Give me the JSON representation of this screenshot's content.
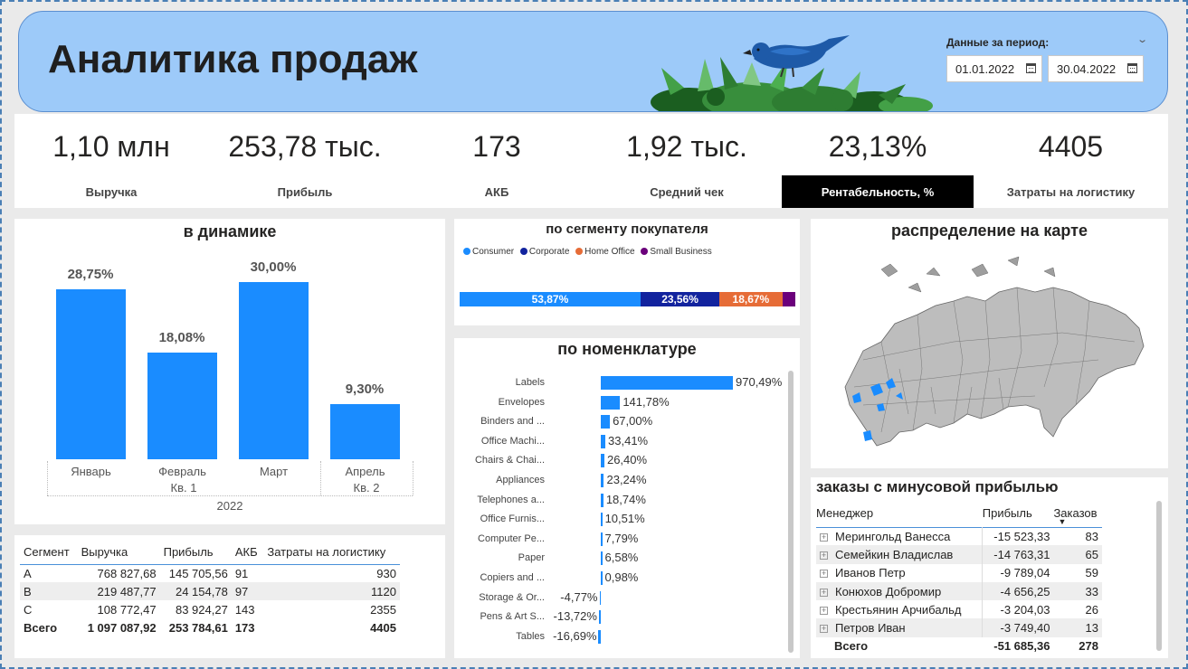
{
  "header": {
    "title": "Аналитика продаж",
    "period_label": "Данные за период:",
    "date_from": "01.01.2022",
    "date_to": "30.04.2022"
  },
  "kpis": [
    {
      "value": "1,10 млн",
      "label": "Выручка"
    },
    {
      "value": "253,78 тыс.",
      "label": "Прибыль"
    },
    {
      "value": "173",
      "label": "АКБ"
    },
    {
      "value": "1,92 тыс.",
      "label": "Средний чек"
    },
    {
      "value": "23,13%",
      "label": "Рентабельность, %"
    },
    {
      "value": "4405",
      "label": "Затраты на логистику"
    }
  ],
  "dynamics": {
    "title": "в динамике",
    "year_label": "2022",
    "quarter1": "Кв. 1",
    "quarter2": "Кв. 2",
    "chart_data": {
      "type": "bar",
      "categories": [
        "Январь",
        "Февраль",
        "Март",
        "Апрель"
      ],
      "values": [
        28.75,
        18.08,
        30.0,
        9.3
      ],
      "labels": [
        "28,75%",
        "18,08%",
        "30,00%",
        "9,30%"
      ],
      "ylim": [
        0,
        30
      ],
      "color": "#1a8cff"
    }
  },
  "segment_table": {
    "headers": [
      "Сегмент",
      "Выручка",
      "Прибыль",
      "АКБ",
      "Затраты на логистику"
    ],
    "rows": [
      [
        "A",
        "768 827,68",
        "145 705,56",
        "91",
        "930"
      ],
      [
        "B",
        "219 487,77",
        "24 154,78",
        "97",
        "1120"
      ],
      [
        "C",
        "108 772,47",
        "83 924,27",
        "143",
        "2355"
      ]
    ],
    "total": [
      "Всего",
      "1 097 087,92",
      "253 784,61",
      "173",
      "4405"
    ]
  },
  "buyer_segment": {
    "title": "по сегменту покупателя",
    "chart_data": {
      "type": "bar",
      "orientation": "stacked-100",
      "series": [
        {
          "name": "Consumer",
          "value": 53.87,
          "label": "53,87%",
          "color": "#1a8cff"
        },
        {
          "name": "Corporate",
          "value": 23.56,
          "label": "23,56%",
          "color": "#12239e"
        },
        {
          "name": "Home Office",
          "value": 18.67,
          "label": "18,67%",
          "color": "#e66c37"
        },
        {
          "name": "Small Business",
          "value": 3.9,
          "label": "",
          "color": "#6b007b"
        }
      ]
    }
  },
  "nomenclature": {
    "title": "по номенклатуре",
    "chart_data": {
      "type": "bar",
      "orientation": "horizontal",
      "categories": [
        "Labels",
        "Envelopes",
        "Binders and ...",
        "Office Machi...",
        "Chairs & Chai...",
        "Appliances",
        "Telephones a...",
        "Office Furnis...",
        "Computer Pe...",
        "Paper",
        "Copiers and ...",
        "Storage & Or...",
        "Pens & Art S...",
        "Tables"
      ],
      "values": [
        970.49,
        141.78,
        67.0,
        33.41,
        26.4,
        23.24,
        18.74,
        10.51,
        7.79,
        6.58,
        0.98,
        -4.77,
        -13.72,
        -16.69
      ],
      "labels": [
        "970,49%",
        "141,78%",
        "67,00%",
        "33,41%",
        "26,40%",
        "23,24%",
        "18,74%",
        "10,51%",
        "7,79%",
        "6,58%",
        "0,98%",
        "-4,77%",
        "-13,72%",
        "-16,69%"
      ]
    }
  },
  "map": {
    "title": "распределение на карте"
  },
  "negative": {
    "title": "заказы с минусовой прибылью",
    "headers": [
      "Менеджер",
      "Прибыль",
      "Заказов"
    ],
    "rows": [
      [
        "Мерингольд Ванесса",
        "-15 523,33",
        "83"
      ],
      [
        "Семейкин Владислав",
        "-14 763,31",
        "65"
      ],
      [
        "Иванов Петр",
        "-9 789,04",
        "59"
      ],
      [
        "Конюхов Добромир",
        "-4 656,25",
        "33"
      ],
      [
        "Крестьянин Арчибальд",
        "-3 204,03",
        "26"
      ],
      [
        "Петров Иван",
        "-3 749,40",
        "13"
      ]
    ],
    "total": [
      "Всего",
      "-51 685,36",
      "278"
    ]
  },
  "colors": {
    "accent": "#1a8cff",
    "header_bg": "#9dcaf9",
    "active_kpi_bg": "#000000",
    "map_highlight": "#1a8cff"
  }
}
